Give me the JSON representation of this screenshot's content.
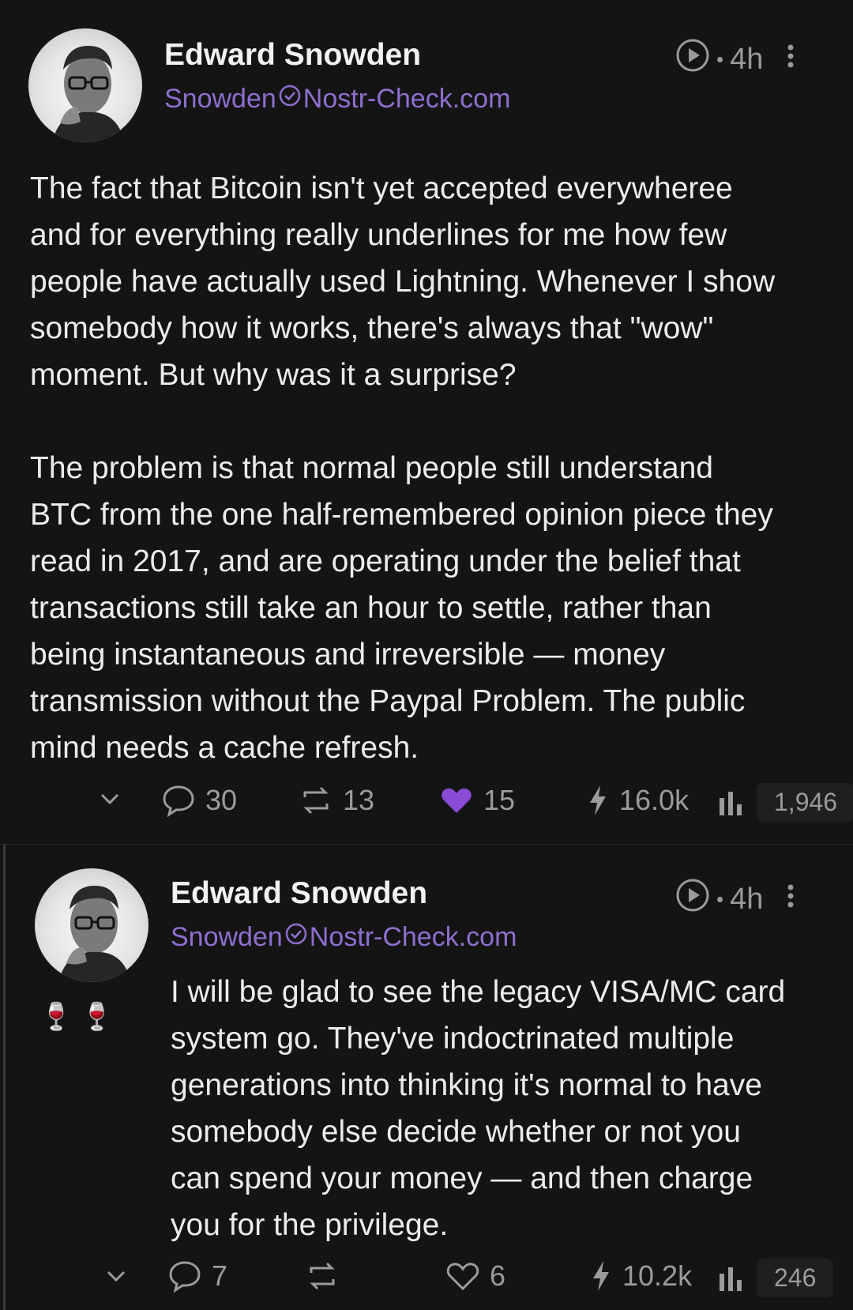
{
  "posts": [
    {
      "author": {
        "name": "Edward Snowden",
        "handle_user": "Snowden",
        "handle_domain": "Nostr-Check.com"
      },
      "time": "4h",
      "text": "The fact that Bitcoin isn't yet accepted everywheree\nand for everything really underlines for me how few\npeople have actually used Lightning. Whenever I show\nsomebody how it works, there's always that \"wow\"\nmoment. But why was it a surprise?\n\nThe problem is that normal people still understand\nBTC from the one half-remembered opinion piece they\nread in 2017, and are operating under the belief that\ntransactions still take an hour to settle, rather than\nbeing instantaneous and irreversible — money\ntransmission without the Paypal Problem. The public\nmind needs a cache refresh.",
      "stats": {
        "replies": "30",
        "reposts": "13",
        "likes": "15",
        "zaps": "16.0k",
        "views": "1,946"
      },
      "like_color": "#8a4bd6"
    },
    {
      "author": {
        "name": "Edward Snowden",
        "handle_user": "Snowden",
        "handle_domain": "Nostr-Check.com"
      },
      "time": "4h",
      "badges": "🍷 🍷",
      "text": "I will be glad to see the legacy VISA/MC card\nsystem go. They've indoctrinated multiple\ngenerations into thinking it's normal to have\nsomebody else decide whether or not you\ncan spend your money — and then charge\nyou for the privilege.",
      "stats": {
        "replies": "7",
        "reposts": "",
        "likes": "6",
        "zaps": "10.2k",
        "views": "246"
      }
    }
  ],
  "colors": {
    "background": "#141414",
    "handle": "#8e6fd0",
    "muted": "#9b9b9b"
  }
}
